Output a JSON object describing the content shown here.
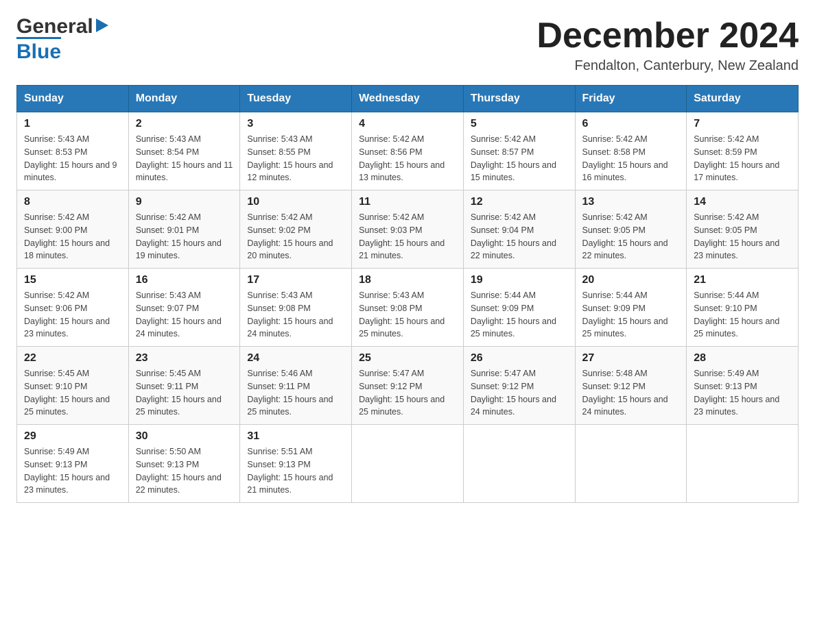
{
  "logo": {
    "general": "General",
    "blue": "Blue"
  },
  "header": {
    "title": "December 2024",
    "location": "Fendalton, Canterbury, New Zealand"
  },
  "days_of_week": [
    "Sunday",
    "Monday",
    "Tuesday",
    "Wednesday",
    "Thursday",
    "Friday",
    "Saturday"
  ],
  "weeks": [
    [
      {
        "num": "1",
        "sunrise": "5:43 AM",
        "sunset": "8:53 PM",
        "daylight": "15 hours and 9 minutes."
      },
      {
        "num": "2",
        "sunrise": "5:43 AM",
        "sunset": "8:54 PM",
        "daylight": "15 hours and 11 minutes."
      },
      {
        "num": "3",
        "sunrise": "5:43 AM",
        "sunset": "8:55 PM",
        "daylight": "15 hours and 12 minutes."
      },
      {
        "num": "4",
        "sunrise": "5:42 AM",
        "sunset": "8:56 PM",
        "daylight": "15 hours and 13 minutes."
      },
      {
        "num": "5",
        "sunrise": "5:42 AM",
        "sunset": "8:57 PM",
        "daylight": "15 hours and 15 minutes."
      },
      {
        "num": "6",
        "sunrise": "5:42 AM",
        "sunset": "8:58 PM",
        "daylight": "15 hours and 16 minutes."
      },
      {
        "num": "7",
        "sunrise": "5:42 AM",
        "sunset": "8:59 PM",
        "daylight": "15 hours and 17 minutes."
      }
    ],
    [
      {
        "num": "8",
        "sunrise": "5:42 AM",
        "sunset": "9:00 PM",
        "daylight": "15 hours and 18 minutes."
      },
      {
        "num": "9",
        "sunrise": "5:42 AM",
        "sunset": "9:01 PM",
        "daylight": "15 hours and 19 minutes."
      },
      {
        "num": "10",
        "sunrise": "5:42 AM",
        "sunset": "9:02 PM",
        "daylight": "15 hours and 20 minutes."
      },
      {
        "num": "11",
        "sunrise": "5:42 AM",
        "sunset": "9:03 PM",
        "daylight": "15 hours and 21 minutes."
      },
      {
        "num": "12",
        "sunrise": "5:42 AM",
        "sunset": "9:04 PM",
        "daylight": "15 hours and 22 minutes."
      },
      {
        "num": "13",
        "sunrise": "5:42 AM",
        "sunset": "9:05 PM",
        "daylight": "15 hours and 22 minutes."
      },
      {
        "num": "14",
        "sunrise": "5:42 AM",
        "sunset": "9:05 PM",
        "daylight": "15 hours and 23 minutes."
      }
    ],
    [
      {
        "num": "15",
        "sunrise": "5:42 AM",
        "sunset": "9:06 PM",
        "daylight": "15 hours and 23 minutes."
      },
      {
        "num": "16",
        "sunrise": "5:43 AM",
        "sunset": "9:07 PM",
        "daylight": "15 hours and 24 minutes."
      },
      {
        "num": "17",
        "sunrise": "5:43 AM",
        "sunset": "9:08 PM",
        "daylight": "15 hours and 24 minutes."
      },
      {
        "num": "18",
        "sunrise": "5:43 AM",
        "sunset": "9:08 PM",
        "daylight": "15 hours and 25 minutes."
      },
      {
        "num": "19",
        "sunrise": "5:44 AM",
        "sunset": "9:09 PM",
        "daylight": "15 hours and 25 minutes."
      },
      {
        "num": "20",
        "sunrise": "5:44 AM",
        "sunset": "9:09 PM",
        "daylight": "15 hours and 25 minutes."
      },
      {
        "num": "21",
        "sunrise": "5:44 AM",
        "sunset": "9:10 PM",
        "daylight": "15 hours and 25 minutes."
      }
    ],
    [
      {
        "num": "22",
        "sunrise": "5:45 AM",
        "sunset": "9:10 PM",
        "daylight": "15 hours and 25 minutes."
      },
      {
        "num": "23",
        "sunrise": "5:45 AM",
        "sunset": "9:11 PM",
        "daylight": "15 hours and 25 minutes."
      },
      {
        "num": "24",
        "sunrise": "5:46 AM",
        "sunset": "9:11 PM",
        "daylight": "15 hours and 25 minutes."
      },
      {
        "num": "25",
        "sunrise": "5:47 AM",
        "sunset": "9:12 PM",
        "daylight": "15 hours and 25 minutes."
      },
      {
        "num": "26",
        "sunrise": "5:47 AM",
        "sunset": "9:12 PM",
        "daylight": "15 hours and 24 minutes."
      },
      {
        "num": "27",
        "sunrise": "5:48 AM",
        "sunset": "9:12 PM",
        "daylight": "15 hours and 24 minutes."
      },
      {
        "num": "28",
        "sunrise": "5:49 AM",
        "sunset": "9:13 PM",
        "daylight": "15 hours and 23 minutes."
      }
    ],
    [
      {
        "num": "29",
        "sunrise": "5:49 AM",
        "sunset": "9:13 PM",
        "daylight": "15 hours and 23 minutes."
      },
      {
        "num": "30",
        "sunrise": "5:50 AM",
        "sunset": "9:13 PM",
        "daylight": "15 hours and 22 minutes."
      },
      {
        "num": "31",
        "sunrise": "5:51 AM",
        "sunset": "9:13 PM",
        "daylight": "15 hours and 21 minutes."
      },
      null,
      null,
      null,
      null
    ]
  ]
}
